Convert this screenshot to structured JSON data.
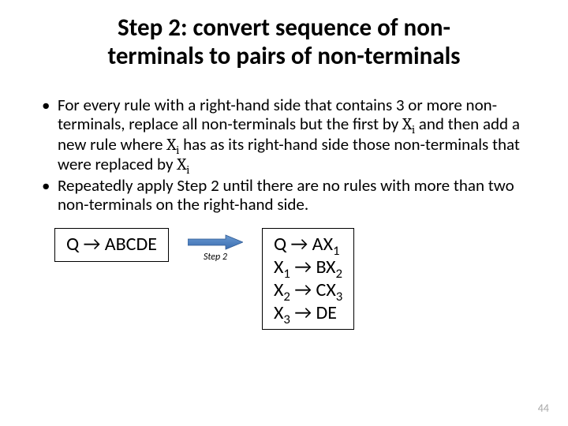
{
  "title_l1": "Step 2: convert sequence of non-",
  "title_l2": "terminals to pairs of non-terminals",
  "bullet1_a": "For every rule with a right-hand side that contains 3 or more non-terminals, replace all non-terminals but the first by ",
  "xi_main": "X",
  "xi_sub": "i",
  "bullet1_b": " and then add a new rule where ",
  "bullet1_c": " has as its right-hand side those non-terminals that were replaced by ",
  "bullet2": "Repeatedly apply Step 2 until there are no rules with more than two non-terminals on the right-hand side.",
  "left_rule": "Q → ABCDE",
  "arrow_label": "Step 2",
  "r1a": "Q → AX",
  "r1s": "1",
  "r2a": "X",
  "r2s": "1",
  "r2b": " → BX",
  "r2s2": "2",
  "r3a": "X",
  "r3s": "2",
  "r3b": " → CX",
  "r3s2": "3",
  "r4a": "X",
  "r4s": "3",
  "r4b": " → DE",
  "page_number": "44"
}
